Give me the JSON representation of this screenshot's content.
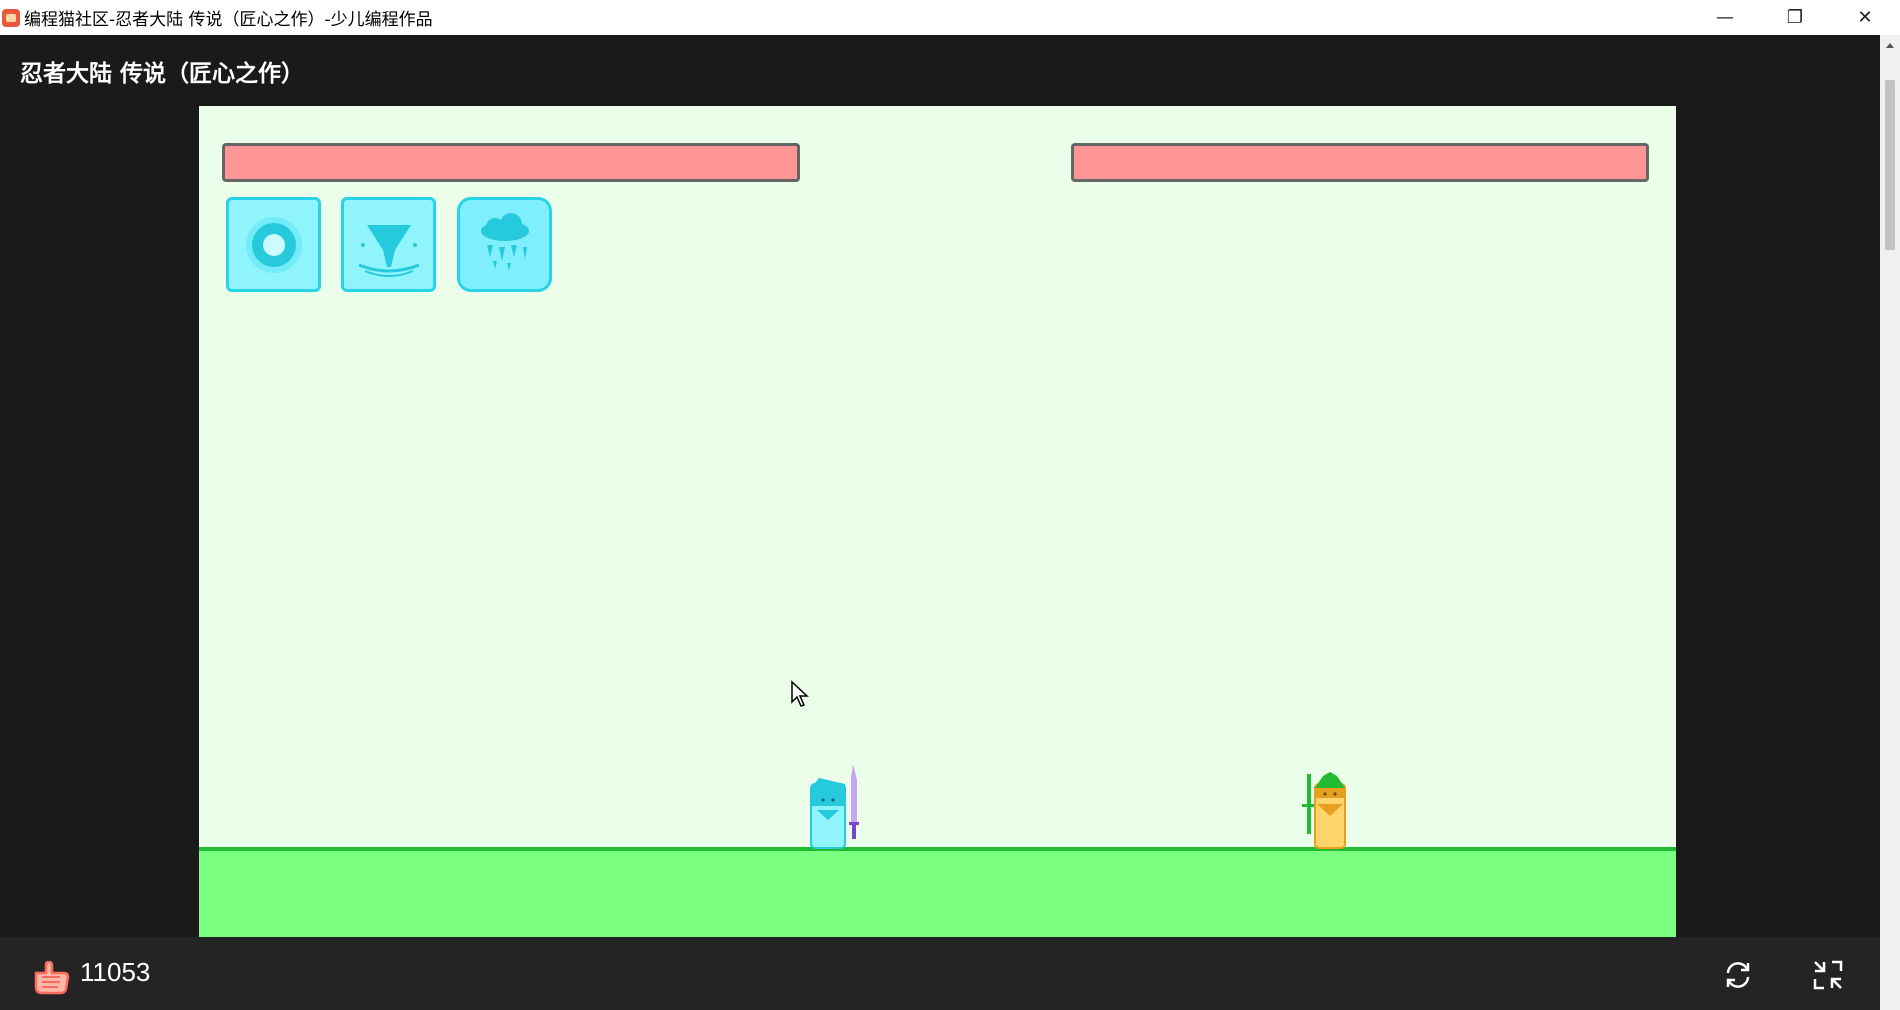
{
  "window": {
    "title": "编程猫社区-忍者大陆 传说（匠心之作）-少儿编程作品",
    "minimize": "—",
    "restore": "❐",
    "close": "✕"
  },
  "page": {
    "title": "忍者大陆 传说（匠心之作）"
  },
  "game": {
    "player_hp": 1.0,
    "enemy_hp": 1.0,
    "skills": [
      "ring-skill-icon",
      "tornado-skill-icon",
      "ice-rain-skill-icon"
    ]
  },
  "footer": {
    "like_count": "11053"
  },
  "colors": {
    "stage_bg": "#eafeea",
    "hp_fill": "#ff9696",
    "ground": "#7bff80",
    "skill_bg": "#8ff4fb",
    "skill_border": "#27d3e6"
  }
}
